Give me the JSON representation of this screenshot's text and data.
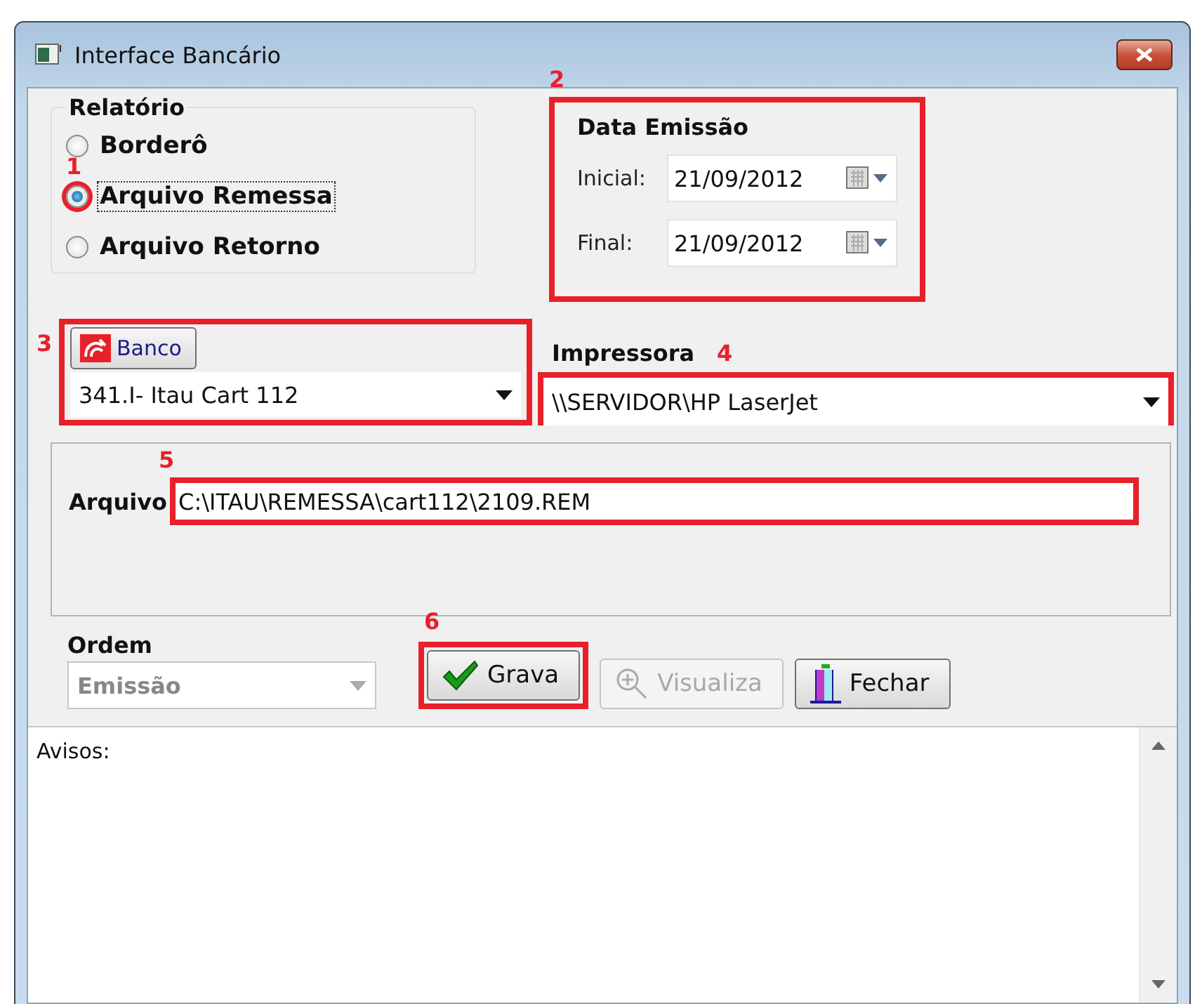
{
  "window": {
    "title": "Interface Bancário"
  },
  "report": {
    "label": "Relatório",
    "options": [
      {
        "label": "Borderô",
        "selected": false
      },
      {
        "label": "Arquivo Remessa",
        "selected": true,
        "annotation": "1"
      },
      {
        "label": "Arquivo Retorno",
        "selected": false
      }
    ]
  },
  "issue_date": {
    "label": "Data Emissão",
    "annotation": "2",
    "fields": [
      {
        "label": "Inicial:",
        "value": "21/09/2012"
      },
      {
        "label": "Final:",
        "value": "21/09/2012"
      }
    ]
  },
  "bank": {
    "annotation": "3",
    "button": "Banco",
    "value": "341.I- Itau Cart 112"
  },
  "printer": {
    "label": "Impressora",
    "annotation": "4",
    "value": "\\\\SERVIDOR\\HP LaserJet"
  },
  "file": {
    "label": "Arquivo",
    "annotation": "5",
    "value": "C:\\ITAU\\REMESSA\\cart112\\2109.REM"
  },
  "order": {
    "label": "Ordem",
    "value": "Emissão",
    "disabled": true
  },
  "buttons": [
    {
      "label": "Grava",
      "kind": "save",
      "disabled": false,
      "annotation": "6"
    },
    {
      "label": "Visualiza",
      "kind": "preview",
      "disabled": true
    },
    {
      "label": "Fechar",
      "kind": "close",
      "disabled": false
    }
  ],
  "messages": {
    "label": "Avisos:"
  }
}
